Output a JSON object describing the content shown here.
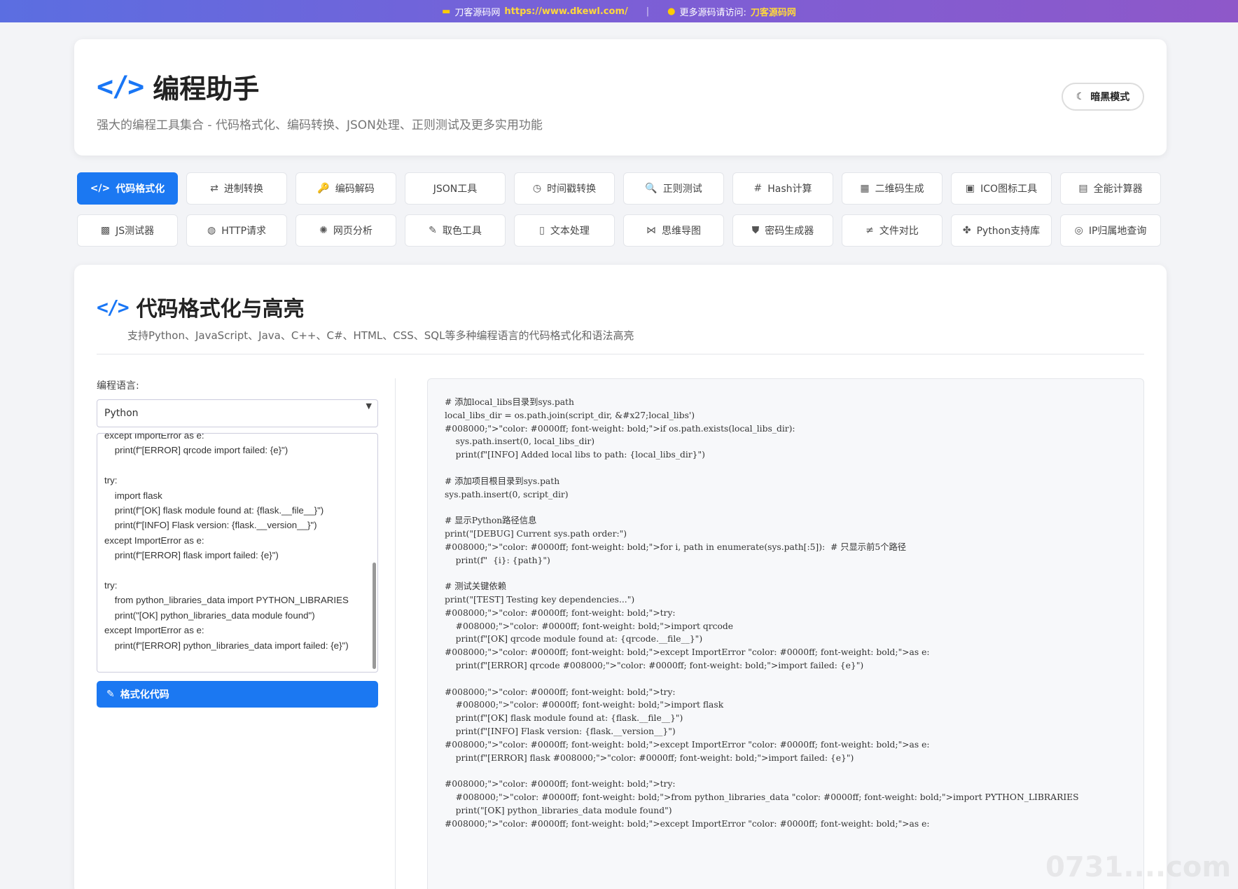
{
  "topbar": {
    "site_name": "刀客源码网",
    "site_url": "https://www.dkewl.com/",
    "divider": "|",
    "more_text": "更多源码请访问:",
    "more_link": "刀客源码网"
  },
  "header": {
    "icon": "</>",
    "title": "编程助手",
    "subtitle": "强大的编程工具集合 - 代码格式化、编码转换、JSON处理、正则测试及更多实用功能",
    "dark_mode_label": "暗黑模式"
  },
  "tools": [
    {
      "label": "代码格式化",
      "icon": "</>",
      "active": true
    },
    {
      "label": "进制转换",
      "icon": "⇄"
    },
    {
      "label": "编码解码",
      "icon": "🔑"
    },
    {
      "label": "JSON工具",
      "icon": ""
    },
    {
      "label": "时间戳转换",
      "icon": "◷"
    },
    {
      "label": "正则测试",
      "icon": "🔍"
    },
    {
      "label": "Hash计算",
      "icon": "#"
    },
    {
      "label": "二维码生成",
      "icon": "▦"
    },
    {
      "label": "ICO图标工具",
      "icon": "▣"
    },
    {
      "label": "全能计算器",
      "icon": "▤"
    },
    {
      "label": "JS测试器",
      "icon": "▩"
    },
    {
      "label": "HTTP请求",
      "icon": "◍"
    },
    {
      "label": "网页分析",
      "icon": "✺"
    },
    {
      "label": "取色工具",
      "icon": "✎"
    },
    {
      "label": "文本处理",
      "icon": "▯"
    },
    {
      "label": "思维导图",
      "icon": "⋈"
    },
    {
      "label": "密码生成器",
      "icon": "⛊"
    },
    {
      "label": "文件对比",
      "icon": "≠"
    },
    {
      "label": "Python支持库",
      "icon": "✤"
    },
    {
      "label": "IP归属地查询",
      "icon": "◎"
    }
  ],
  "main": {
    "icon": "</>",
    "title": "代码格式化与高亮",
    "description": "支持Python、JavaScript、Java、C++、C#、HTML、CSS、SQL等多种编程语言的代码格式化和语法高亮",
    "language_label": "编程语言:",
    "language_value": "Python",
    "input_code": "except ImportError as e:\n    print(f\"[ERROR] qrcode import failed: {e}\")\n\ntry:\n    import flask\n    print(f\"[OK] flask module found at: {flask.__file__}\")\n    print(f\"[INFO] Flask version: {flask.__version__}\")\nexcept ImportError as e:\n    print(f\"[ERROR] flask import failed: {e}\")\n\ntry:\n    from python_libraries_data import PYTHON_LIBRARIES\n    print(\"[OK] python_libraries_data module found\")\nexcept ImportError as e:\n    print(f\"[ERROR] python_libraries_data import failed: {e}\")",
    "format_button": "格式化代码",
    "output_code": "# 添加local_libs目录到sys.path\nlocal_libs_dir = os.path.join(script_dir, &#x27;local_libs')\n#008000;\">\"color: #0000ff; font-weight: bold;\">if os.path.exists(local_libs_dir):\n    sys.path.insert(0, local_libs_dir)\n    print(f\"[INFO] Added local libs to path: {local_libs_dir}\")\n\n# 添加项目根目录到sys.path\nsys.path.insert(0, script_dir)\n\n# 显示Python路径信息\nprint(\"[DEBUG] Current sys.path order:\")\n#008000;\">\"color: #0000ff; font-weight: bold;\">for i, path in enumerate(sys.path[:5]):  # 只显示前5个路径\n    print(f\"  {i}: {path}\")\n\n# 测试关键依赖\nprint(\"[TEST] Testing key dependencies...\")\n#008000;\">\"color: #0000ff; font-weight: bold;\">try:\n    #008000;\">\"color: #0000ff; font-weight: bold;\">import qrcode\n    print(f\"[OK] qrcode module found at: {qrcode.__file__}\")\n#008000;\">\"color: #0000ff; font-weight: bold;\">except ImportError \"color: #0000ff; font-weight: bold;\">as e:\n    print(f\"[ERROR] qrcode #008000;\">\"color: #0000ff; font-weight: bold;\">import failed: {e}\")\n\n#008000;\">\"color: #0000ff; font-weight: bold;\">try:\n    #008000;\">\"color: #0000ff; font-weight: bold;\">import flask\n    print(f\"[OK] flask module found at: {flask.__file__}\")\n    print(f\"[INFO] Flask version: {flask.__version__}\")\n#008000;\">\"color: #0000ff; font-weight: bold;\">except ImportError \"color: #0000ff; font-weight: bold;\">as e:\n    print(f\"[ERROR] flask #008000;\">\"color: #0000ff; font-weight: bold;\">import failed: {e}\")\n\n#008000;\">\"color: #0000ff; font-weight: bold;\">try:\n    #008000;\">\"color: #0000ff; font-weight: bold;\">from python_libraries_data \"color: #0000ff; font-weight: bold;\">import PYTHON_LIBRARIES\n    print(\"[OK] python_libraries_data module found\")\n#008000;\">\"color: #0000ff; font-weight: bold;\">except ImportError \"color: #0000ff; font-weight: bold;\">as e:"
  },
  "watermark": "0731....com",
  "colors": {
    "accent": "#1b78f2",
    "banner_start": "#5b6ee1",
    "banner_end": "#8e58c9",
    "banner_highlight": "#ffd83b"
  }
}
